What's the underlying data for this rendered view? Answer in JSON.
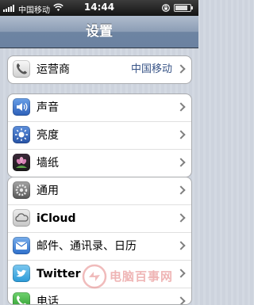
{
  "status_bar": {
    "carrier": "中国移动",
    "time": "14:44"
  },
  "nav": {
    "title": "设置"
  },
  "groups": [
    {
      "rows": [
        {
          "icon": "phone-icon",
          "label": "运营商",
          "value": "中国移动"
        }
      ]
    },
    {
      "rows": [
        {
          "icon": "speaker-icon",
          "label": "声音"
        },
        {
          "icon": "brightness-icon",
          "label": "亮度"
        },
        {
          "icon": "wallpaper-icon",
          "label": "墙纸"
        }
      ]
    },
    {
      "rows": [
        {
          "icon": "gears-icon",
          "label": "通用"
        },
        {
          "icon": "icloud-icon",
          "label": "iCloud"
        },
        {
          "icon": "mail-icon",
          "label": "邮件、通讯录、日历"
        },
        {
          "icon": "twitter-icon",
          "label": "Twitter"
        },
        {
          "icon": "phone-app-icon",
          "label": "电话"
        }
      ]
    }
  ],
  "watermark": {
    "text": "电脑百事网"
  },
  "colors": {
    "nav_bar": "#8b9db5",
    "value_text": "#385487",
    "background_stripe": "#cdd3dd"
  }
}
